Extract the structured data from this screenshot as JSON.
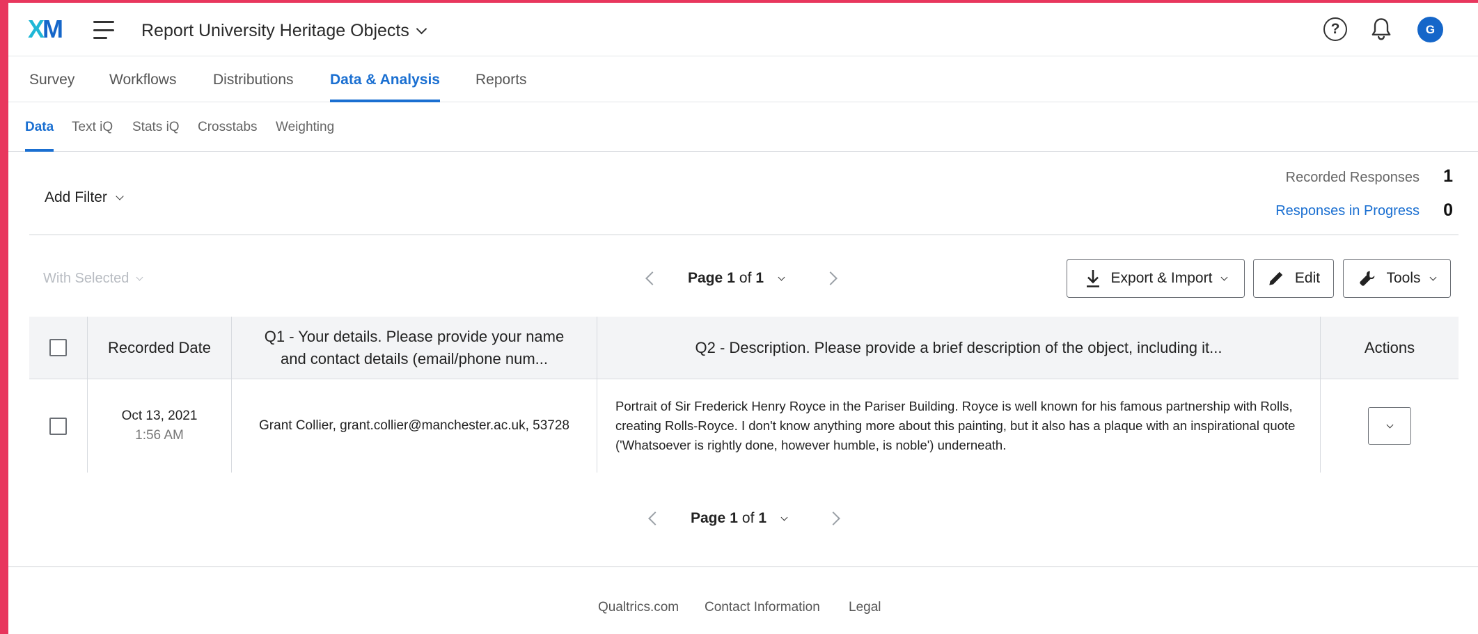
{
  "app": {
    "logo_x": "X",
    "logo_m": "M",
    "project_title": "Report University Heritage Objects",
    "user_initial": "G"
  },
  "main_nav": {
    "tabs": [
      {
        "label": "Survey",
        "active": false
      },
      {
        "label": "Workflows",
        "active": false
      },
      {
        "label": "Distributions",
        "active": false
      },
      {
        "label": "Data & Analysis",
        "active": true
      },
      {
        "label": "Reports",
        "active": false
      }
    ]
  },
  "sub_nav": {
    "tabs": [
      {
        "label": "Data",
        "active": true
      },
      {
        "label": "Text iQ",
        "active": false
      },
      {
        "label": "Stats iQ",
        "active": false
      },
      {
        "label": "Crosstabs",
        "active": false
      },
      {
        "label": "Weighting",
        "active": false
      }
    ]
  },
  "filters": {
    "add_filter_label": "Add Filter"
  },
  "responses": {
    "recorded_label": "Recorded Responses",
    "recorded_count": "1",
    "in_progress_label": "Responses in Progress",
    "in_progress_count": "0"
  },
  "toolbar": {
    "with_selected_label": "With Selected",
    "export_import_label": "Export & Import",
    "edit_label": "Edit",
    "tools_label": "Tools"
  },
  "pagination": {
    "page_word": "Page",
    "current_page": "1",
    "of_word": "of",
    "total_pages": "1"
  },
  "table": {
    "headers": {
      "recorded_date": "Recorded Date",
      "q1": "Q1 - Your details. Please provide your name and contact details (email/phone num...",
      "q2": "Q2 - Description. Please provide a brief description of the object, including it...",
      "actions": "Actions"
    },
    "rows": [
      {
        "date": "Oct 13, 2021",
        "time": "1:56 AM",
        "q1": "Grant Collier, grant.collier@manchester.ac.uk, 53728",
        "q2": "Portrait of Sir Frederick Henry Royce in the Pariser Building. Royce is well known for his famous partnership with Rolls, creating Rolls-Royce. I don't know anything more about this painting, but it also has a plaque with an inspirational quote ('Whatsoever is rightly done, however humble, is noble') underneath."
      }
    ]
  },
  "footer": {
    "links": [
      "Qualtrics.com",
      "Contact Information",
      "Legal"
    ]
  },
  "colors": {
    "accent": "#1a6fd1",
    "frame": "#e8365d",
    "logo_cyan": "#1fb7d6",
    "logo_blue": "#1566c9"
  }
}
